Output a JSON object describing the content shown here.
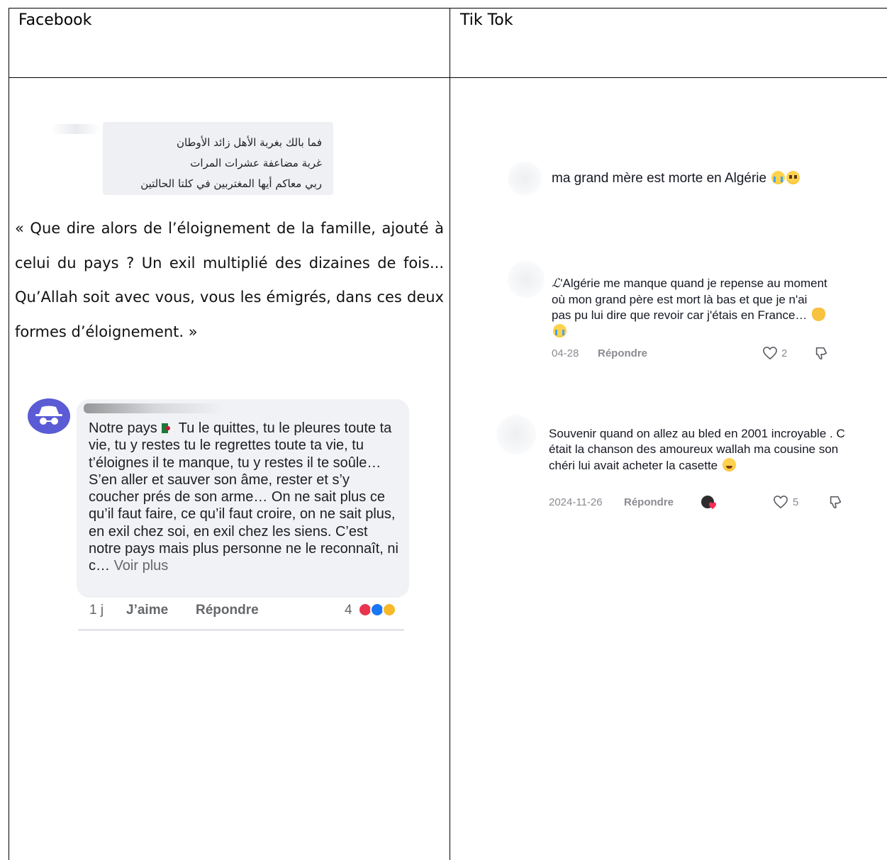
{
  "table": {
    "col1_header": "Facebook",
    "col2_header": "Tik Tok"
  },
  "facebook": {
    "arabic_comment": [
      "فما بالك بغربة الأهل زائد الأوطان",
      "غربة مضاعفة عشرات المرات",
      "ربي معاكم أيها المغتربين في كلتا الحالتين"
    ],
    "translation": "« Que dire alors de l’éloignement de la famille, ajouté à celui du pays ? Un exil multiplié des dizaines de fois... Qu’Allah soit avec vous, vous les émigrés, dans ces deux formes d’éloignement. »",
    "comment2": {
      "text_before_flag": "Notre pays",
      "text_after_flag": "Tu le quittes, tu le pleures toute ta vie, tu y restes tu le regrettes toute ta vie, tu t’éloignes il te manque, tu y restes il te soûle… S’en aller et sauver son âme, rester et s’y coucher prés de son arme… On ne sait plus ce qu’il faut faire, ce qu’il faut croire, on ne sait plus, en exil chez soi, en exil chez les siens. C’est notre pays mais plus personne ne le reconnaît, ni c…",
      "see_more": "Voir plus",
      "time": "1 j",
      "like": "J’aime",
      "reply": "Répondre",
      "reaction_count": "4",
      "reaction_colors": [
        "#e8344e",
        "#1877f2",
        "#f7b928"
      ],
      "avatar_color": "#5b5bd6"
    }
  },
  "tiktok": {
    "comment1": {
      "text": "ma grand mère est morte en Algérie"
    },
    "comment2": {
      "lead_letter": "ℒ",
      "text": "'Algérie me manque quand je repense au moment où mon grand père est mort là bas et que je n'ai pas pu lui dire que revoir car j'étais en France…",
      "date": "04-28",
      "reply": "Répondre",
      "likes": "2"
    },
    "comment3": {
      "text": "Souvenir quand on allez au bled en 2001 incroyable . C était la chanson des amoureux wallah ma cousine son chéri lui avait acheter la casette",
      "date": "2024-11-26",
      "reply": "Répondre",
      "likes": "5"
    }
  }
}
